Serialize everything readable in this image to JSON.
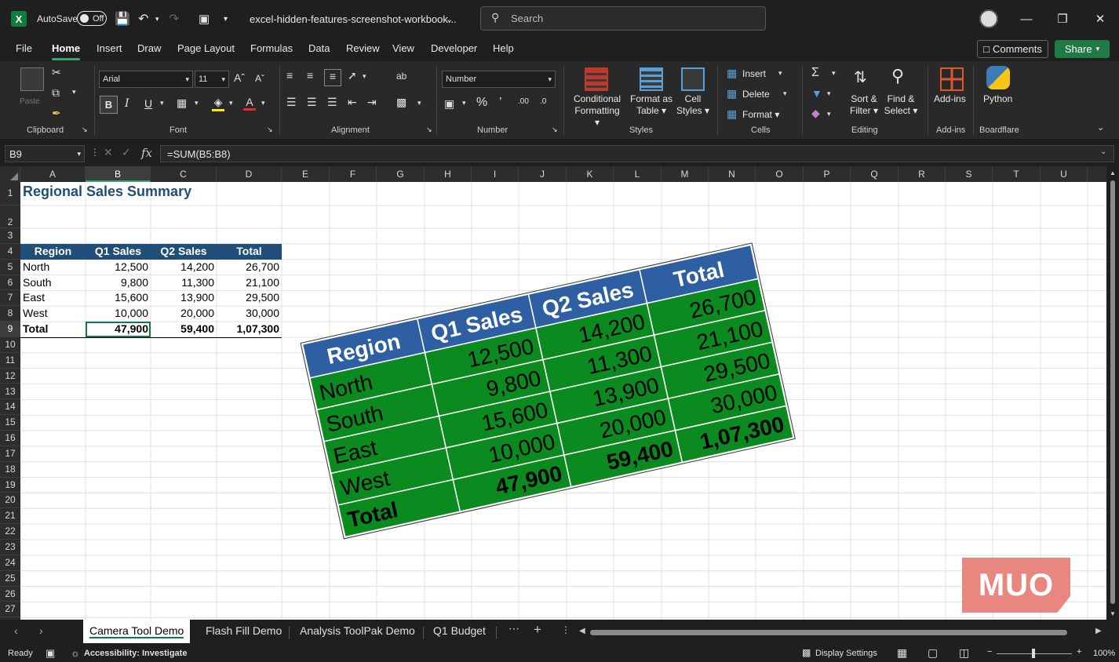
{
  "titlebar": {
    "autosave_label": "AutoSave",
    "autosave_state": "Off",
    "filename": "excel-hidden-features-screenshot-workbook...",
    "search_placeholder": "Search"
  },
  "menu": {
    "tabs": [
      "File",
      "Home",
      "Insert",
      "Draw",
      "Page Layout",
      "Formulas",
      "Data",
      "Review",
      "View",
      "Developer",
      "Help"
    ],
    "active": "Home",
    "comments_label": "Comments",
    "share_label": "Share"
  },
  "ribbon": {
    "clipboard": {
      "label": "Clipboard",
      "paste_label": "Paste"
    },
    "font": {
      "label": "Font",
      "font_name": "Arial",
      "font_size": "11",
      "bold": "B",
      "italic": "I",
      "underline": "U"
    },
    "alignment": {
      "label": "Alignment"
    },
    "number": {
      "label": "Number",
      "format": "Number"
    },
    "styles": {
      "label": "Styles",
      "conditional_1": "Conditional",
      "conditional_2": "Formatting",
      "format_table_1": "Format as",
      "format_table_2": "Table",
      "cell_styles_1": "Cell",
      "cell_styles_2": "Styles"
    },
    "cells": {
      "label": "Cells",
      "insert": "Insert",
      "delete": "Delete",
      "format": "Format"
    },
    "editing": {
      "label": "Editing",
      "sort_1": "Sort &",
      "sort_2": "Filter",
      "find_1": "Find &",
      "find_2": "Select"
    },
    "addins": {
      "label": "Add-ins",
      "addins_btn": "Add-ins"
    },
    "boardflare": {
      "label": "Boardflare",
      "python": "Python"
    }
  },
  "formulabar": {
    "namebox": "B9",
    "fx": "fx",
    "formula": "=SUM(B5:B8)"
  },
  "columns": [
    "A",
    "B",
    "C",
    "D",
    "E",
    "F",
    "G",
    "H",
    "I",
    "J",
    "K",
    "L",
    "M",
    "N",
    "O",
    "P",
    "Q",
    "R",
    "S",
    "T",
    "U"
  ],
  "rows": [
    "1",
    "2",
    "3",
    "4",
    "5",
    "6",
    "7",
    "8",
    "9",
    "10",
    "11",
    "12",
    "13",
    "14",
    "15",
    "16",
    "17",
    "18",
    "19",
    "20",
    "21",
    "22",
    "23",
    "24",
    "25",
    "26",
    "27"
  ],
  "sheet": {
    "title": "Regional Sales Summary",
    "headers": [
      "Region",
      "Q1 Sales",
      "Q2 Sales",
      "Total"
    ],
    "data_rows": [
      [
        "North",
        "12,500",
        "14,200",
        "26,700"
      ],
      [
        "South",
        "9,800",
        "11,300",
        "21,100"
      ],
      [
        "East",
        "15,600",
        "13,900",
        "29,500"
      ],
      [
        "West",
        "10,000",
        "20,000",
        "30,000"
      ]
    ],
    "total_row": [
      "Total",
      "47,900",
      "59,400",
      "1,07,300"
    ]
  },
  "camera_picture": {
    "headers": [
      "Region",
      "Q1 Sales",
      "Q2 Sales",
      "Total"
    ],
    "rows": [
      [
        "North",
        "12,500",
        "14,200",
        "26,700"
      ],
      [
        "South",
        "9,800",
        "11,300",
        "21,100"
      ],
      [
        "East",
        "15,600",
        "13,900",
        "29,500"
      ],
      [
        "West",
        "10,000",
        "20,000",
        "30,000"
      ],
      [
        "Total",
        "47,900",
        "59,400",
        "1,07,300"
      ]
    ],
    "header_color": "#2e5fa3",
    "body_color": "#0a8a1f"
  },
  "sheet_tabs": [
    "Camera Tool Demo",
    "Flash Fill Demo",
    "Analysis ToolPak Demo",
    "Q1 Budget"
  ],
  "active_sheet": "Camera Tool Demo",
  "statusbar": {
    "ready": "Ready",
    "accessibility": "Accessibility: Investigate",
    "display_settings": "Display Settings",
    "zoom": "100%"
  },
  "watermark": "MUO",
  "colors": {
    "accent": "#107c41",
    "header_blue": "#1f4e79"
  }
}
